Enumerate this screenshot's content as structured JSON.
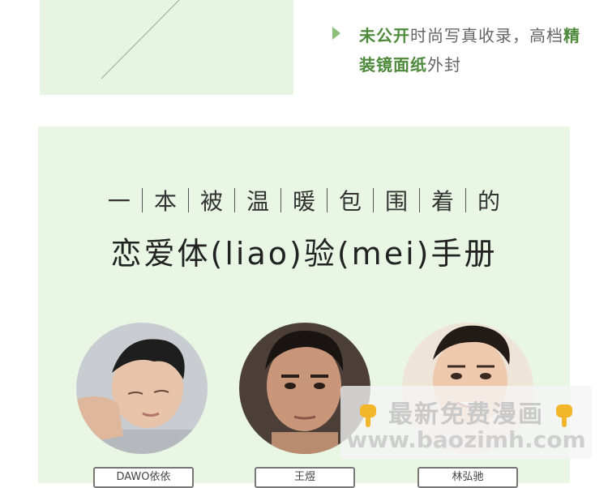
{
  "intro": {
    "highlight1": "未公开",
    "text1": "时尚写真收录，高档",
    "highlight2": "精装镜面纸",
    "text2": "外封"
  },
  "slogan": [
    "一",
    "本",
    "被",
    "温",
    "暖",
    "包",
    "围",
    "着",
    "的"
  ],
  "title": "恋爱体(liao)验(mei)手册",
  "name_tags": [
    "DAWO依依",
    "王煜",
    "林弘驰"
  ],
  "watermark": {
    "line1": "最新免费漫画",
    "line2": "www.baozimh.com"
  },
  "colors": {
    "accent_green": "#4e8a3b",
    "panel_bg": "#e9f6e4"
  }
}
